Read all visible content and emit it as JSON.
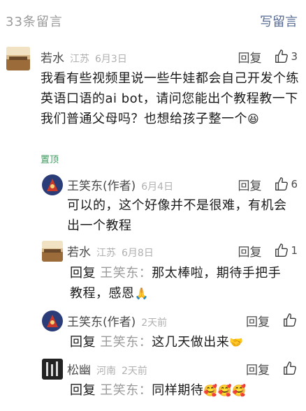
{
  "header": {
    "count_label": "33条留言",
    "write_label": "写留言"
  },
  "comments": [
    {
      "name": "若水",
      "location": "江苏",
      "date": "6月3日",
      "reply_label": "回复",
      "likes": "3",
      "text": "我看有些视频里说一些牛娃都会自己开发个练英语口语的ai bot，请问您能出个教程教一下我们普通父母吗？也想给孩子整一个",
      "emoji": "😆",
      "badge": "置顶"
    },
    {
      "name": "王笑东(作者)",
      "location": "",
      "date": "6月4日",
      "reply_label": "回复",
      "likes": "6",
      "text": "可以的，这个好像并不是很难，有机会出一个教程"
    },
    {
      "name": "若水",
      "location": "江苏",
      "date": "6月8日",
      "reply_label": "回复",
      "likes": "1",
      "reply_prefix": "回复",
      "reply_to": "王笑东：",
      "text": "那太棒啦，期待手把手教程，感恩",
      "emoji": "🙏"
    },
    {
      "name": "王笑东(作者)",
      "location": "",
      "date": "2天前",
      "reply_label": "回复",
      "likes": "",
      "reply_prefix": "回复",
      "reply_to": "王笑东：",
      "text": "这几天做出来",
      "emoji": "🤝"
    },
    {
      "name": "松幽",
      "location": "河南",
      "date": "2天前",
      "reply_label": "回复",
      "likes": "",
      "reply_prefix": "回复",
      "reply_to": "王笑东：",
      "text": "同样期待",
      "emoji": "🥰🥰🥰"
    }
  ]
}
